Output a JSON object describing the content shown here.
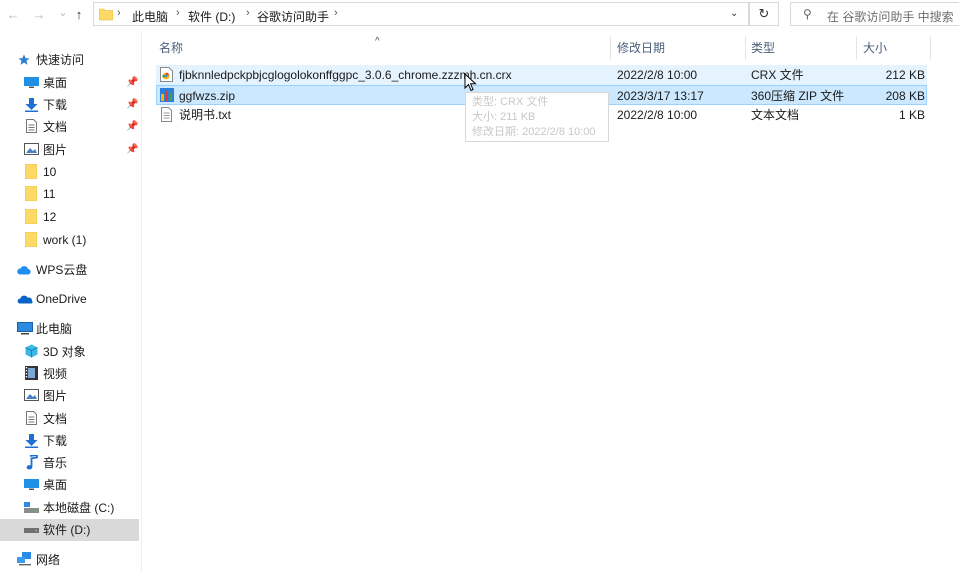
{
  "toolbar": {
    "back": "←",
    "forward": "→",
    "recent": "⌄",
    "up": "↑",
    "breadcrumb": [
      "此电脑",
      "软件 (D:)",
      "谷歌访问助手"
    ],
    "refresh": "↻",
    "search_placeholder": "在 谷歌访问助手 中搜索"
  },
  "sidebar": {
    "quick_access": "快速访问",
    "quick_items": [
      {
        "label": "桌面",
        "icon": "desktop-icon",
        "pinned": true
      },
      {
        "label": "下载",
        "icon": "download-icon",
        "pinned": true
      },
      {
        "label": "文档",
        "icon": "document-icon",
        "pinned": true
      },
      {
        "label": "图片",
        "icon": "pictures-icon",
        "pinned": true
      },
      {
        "label": "10",
        "icon": "folder-icon"
      },
      {
        "label": "11",
        "icon": "folder-icon"
      },
      {
        "label": "12",
        "icon": "folder-icon"
      },
      {
        "label": "work (1)",
        "icon": "folder-icon"
      }
    ],
    "wps": "WPS云盘",
    "onedrive": "OneDrive",
    "this_pc": "此电脑",
    "pc_items": [
      {
        "label": "3D 对象",
        "icon": "3d-objects-icon"
      },
      {
        "label": "视频",
        "icon": "video-icon"
      },
      {
        "label": "图片",
        "icon": "pictures-icon"
      },
      {
        "label": "文档",
        "icon": "document-icon"
      },
      {
        "label": "下载",
        "icon": "download-icon"
      },
      {
        "label": "音乐",
        "icon": "music-icon"
      },
      {
        "label": "桌面",
        "icon": "desktop-icon"
      },
      {
        "label": "本地磁盘 (C:)",
        "icon": "drive-c-icon"
      },
      {
        "label": "软件 (D:)",
        "icon": "drive-d-icon",
        "selected": true
      }
    ],
    "network": "网络"
  },
  "columns": {
    "name": "名称",
    "date": "修改日期",
    "type": "类型",
    "size": "大小"
  },
  "files": [
    {
      "name": "fjbknnledpckpbjcglogolokonffggpc_3.0.6_chrome.zzzmh.cn.crx",
      "date": "2022/2/8 10:00",
      "type": "CRX 文件",
      "size": "212 KB",
      "icon": "crx-file-icon",
      "state": "hover"
    },
    {
      "name": "ggfwzs.zip",
      "date": "2023/3/17 13:17",
      "type": "360压缩 ZIP 文件",
      "size": "208 KB",
      "icon": "zip-file-icon",
      "state": "selected"
    },
    {
      "name": "说明书.txt",
      "date": "2022/2/8 10:00",
      "type": "文本文档",
      "size": "1 KB",
      "icon": "txt-file-icon",
      "state": "normal"
    }
  ],
  "tooltip": {
    "type_line": "类型: CRX 文件",
    "size_line": "大小: 211 KB",
    "date_line": "修改日期: 2022/2/8 10:00"
  },
  "colors": {
    "accent": "#0078d7",
    "folder": "#ffd966",
    "hover": "#e5f3ff",
    "selected": "#cce8ff",
    "selected_border": "#99d1ff"
  }
}
